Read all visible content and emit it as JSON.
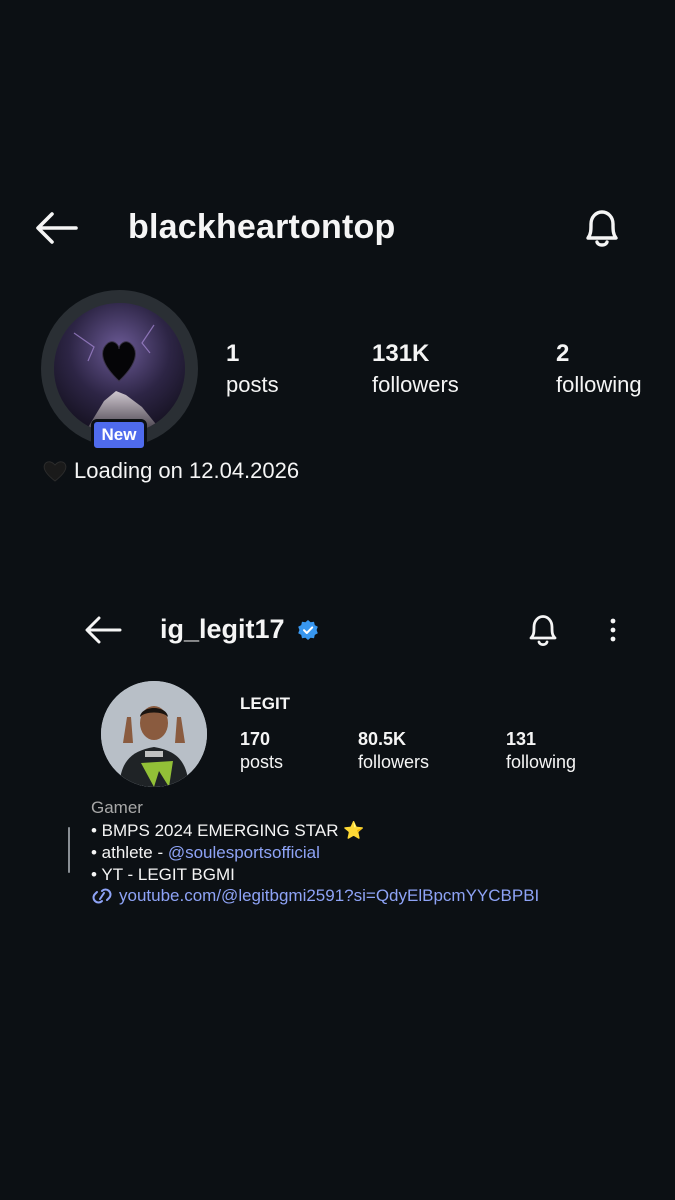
{
  "top_profile": {
    "username": "blackheartontop",
    "avatar_badge": "New",
    "stats": [
      {
        "value": "1",
        "label": "posts"
      },
      {
        "value": "131K",
        "label": "followers"
      },
      {
        "value": "2",
        "label": "following"
      }
    ],
    "bio": "Loading on 12.04.2026",
    "bio_emoji": "black-heart-icon",
    "icons": [
      "back-arrow-icon",
      "bell-icon"
    ]
  },
  "embedded_profile": {
    "username": "ig_legit17",
    "verified": true,
    "display_name": "LEGIT",
    "stats": [
      {
        "value": "170",
        "label": "posts"
      },
      {
        "value": "80.5K",
        "label": "followers"
      },
      {
        "value": "131",
        "label": "following"
      }
    ],
    "category": "Gamer",
    "bio_lines": [
      {
        "text": "• BMPS 2024 EMERGING STAR ⭐"
      },
      {
        "prefix": "• athlete - ",
        "mention": "@soulesportsofficial"
      },
      {
        "text": "• YT - LEGIT BGMI"
      }
    ],
    "link": "youtube.com/@legitbgmi2591?si=QdyElBpcmYYCBPBI",
    "icons": [
      "back-arrow-icon",
      "verified-badge-icon",
      "bell-icon",
      "more-options-icon",
      "link-icon"
    ]
  },
  "colors": {
    "background": "#0c1014",
    "text": "#f5f5f5",
    "muted": "#a8a8a8",
    "link": "#8ea3f6",
    "new_badge": "#4f6bed",
    "verified": "#3897f0"
  }
}
